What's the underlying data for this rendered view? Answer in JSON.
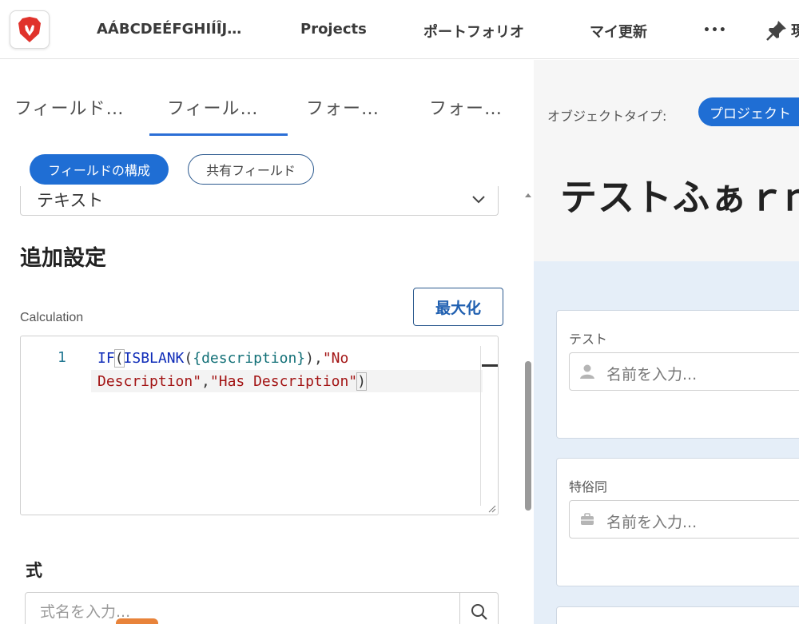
{
  "topbar": {
    "app_name": "AÁBCDEÉFGHIÍÎJ…",
    "projects": "Projects",
    "portfolio": "ポートフォリオ",
    "my_updates": "マイ更新",
    "more": "•••",
    "pinned_label": "現"
  },
  "tabs": [
    {
      "label": "フィールド…"
    },
    {
      "label": "フィール…"
    },
    {
      "label": "フォー…"
    },
    {
      "label": "フォー…"
    }
  ],
  "subtabs": {
    "configure": "フィールドの構成",
    "shared": "共有フィールド"
  },
  "field_type": {
    "value": "テキスト"
  },
  "additional_settings": {
    "title": "追加設定"
  },
  "calculation": {
    "label": "Calculation",
    "maximize": "最大化",
    "line_number": "1"
  },
  "formula_section": {
    "title": "式",
    "search_placeholder": "式名を入力..."
  },
  "preview": {
    "object_type_label": "オブジェクトタイプ:",
    "object_type_value": "プロジェクト",
    "form_title": "テストふぁｒｍ",
    "fields": [
      {
        "label": "テスト",
        "placeholder": "名前を入力..."
      },
      {
        "label": "特俗同",
        "placeholder": "名前を入力..."
      }
    ]
  }
}
